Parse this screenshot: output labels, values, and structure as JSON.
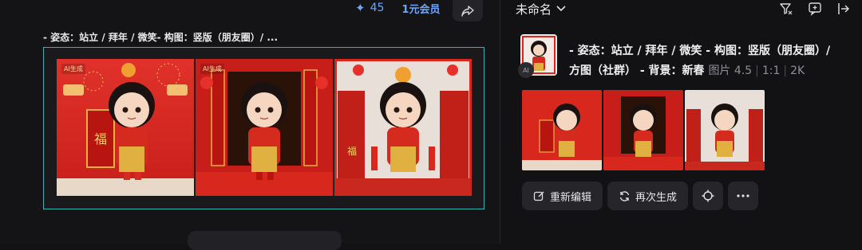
{
  "header": {
    "credits": "45",
    "vip_label": "1元会员",
    "project_name": "未命名"
  },
  "left": {
    "prompt_title": "- 姿态：站立 / 拜年 / 微笑- 构图：竖版（朋友圈）/ ..."
  },
  "tiles": [
    {
      "ai_tag": "AI生成",
      "sign": "福"
    },
    {
      "ai_tag": "AI生成",
      "sign": ""
    },
    {
      "ai_tag": "",
      "sign": "福"
    }
  ],
  "right": {
    "desc_line1": "- 姿态：站立 / 拜年 / 微笑 - 构图：竖版（朋友圈）/",
    "desc_line2": "方图（社群） - 背景：新春",
    "meta_model": "图片 4.5",
    "meta_ratio": "1:1",
    "meta_res": "2K",
    "avatar_text": "AI"
  },
  "actions": {
    "re_edit": "重新编辑",
    "regenerate": "再次生成"
  },
  "colors": {
    "accent_blue": "#6aa6ff",
    "frame_teal": "#2fb3b3",
    "festive_red": "#d8281e"
  }
}
